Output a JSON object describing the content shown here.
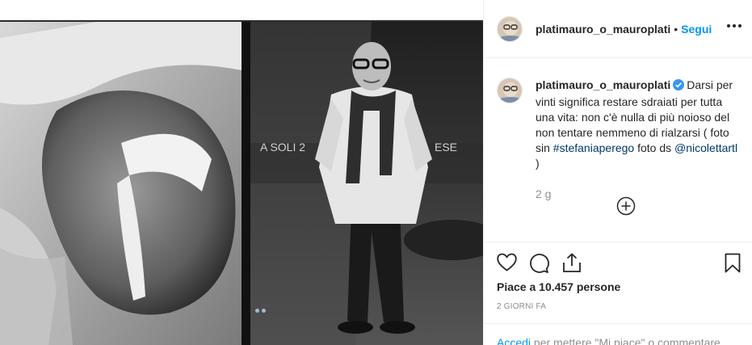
{
  "post": {
    "username": "platimauro_o_mauroplati",
    "separator": "•",
    "follow_label": "Segui"
  },
  "caption": {
    "username": "platimauro_o_mauroplati",
    "text_before": "Darsi per vinti significa restare sdraiati per tutta una vita: non c'è nulla di più noioso del non tentare nemmeno di rialzarsi ( foto sin ",
    "tag": "#stefaniaperego",
    "text_middle": " foto ds ",
    "mention": "@nicolettartl",
    "text_after": " )",
    "time": "2 g"
  },
  "stats": {
    "likes": "Piace a 10.457 persone",
    "date": "2 giorni fa"
  },
  "footer": {
    "login_label": "Accedi",
    "login_rest": " per mettere \"Mi piace\" o commentare"
  },
  "media": {
    "overlay_text_1": "A SOLI 2",
    "overlay_text_2": "ESE"
  },
  "colors": {
    "accent": "#0095f6",
    "link": "#00376b",
    "muted": "#8e8e8e",
    "verified": "#3897f0"
  },
  "icons": [
    "more-icon",
    "verified-icon",
    "load-more-icon",
    "heart-icon",
    "comment-icon",
    "share-icon",
    "bookmark-icon"
  ]
}
